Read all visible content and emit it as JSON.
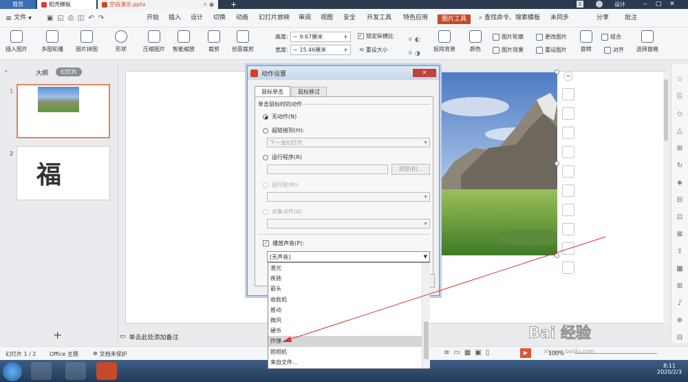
{
  "tabs": {
    "home": "首页",
    "template": "稻壳模板",
    "file": "空白演示.pptx",
    "add": "+",
    "counter": "1",
    "design": "设计"
  },
  "menu": {
    "file": "文件",
    "items": [
      "开始",
      "插入",
      "设计",
      "切换",
      "动画",
      "幻灯片放映",
      "审阅",
      "视图",
      "安全",
      "开发工具",
      "特色应用"
    ],
    "active": "图片工具",
    "search": "查找命令、搜索模板",
    "sync": "未同步",
    "share": "分享",
    "annotate": "批注"
  },
  "ribbon": {
    "buttons": [
      "插入图片",
      "多图轮播",
      "图片拼图",
      "形状",
      "压缩图片",
      "智能缩放",
      "裁剪",
      "创意裁剪"
    ],
    "height_label": "高度:",
    "height_value": "9.67厘米",
    "width_label": "宽度:",
    "width_value": "15.46厘米",
    "lock": "锁定纵横比",
    "reset": "重设大小",
    "cutout": "抠除背景",
    "color": "颜色",
    "outline": "图片轮廓",
    "effect": "图片效果",
    "change": "更改图片",
    "reset_pic": "重设图片",
    "group": "组合",
    "rotate": "旋转",
    "align": "对齐",
    "selection": "选择窗格"
  },
  "left": {
    "outline": "大纲",
    "slides": "幻灯片",
    "slide1": "1",
    "slide2": "2",
    "fu": "福",
    "add": "+"
  },
  "notes": "单击此处添加备注",
  "status": {
    "slides": "幻灯片 1 / 2",
    "theme": "Office 主题",
    "protect": "文档未保护",
    "zoom": "100%"
  },
  "dialog": {
    "title": "动作设置",
    "tab1": "鼠标单击",
    "tab2": "鼠标移过",
    "section": "单击鼠标时的动作",
    "none": "无动作(N)",
    "hyperlink": "超链接到(H):",
    "hyperlink_value": "下一张幻灯片",
    "program": "运行程序(R)",
    "browse": "浏览(B)...",
    "macro": "运行宏(M):",
    "object": "对象动作(A)",
    "sound": "播放声音(P):",
    "sound_value": "[无声音]"
  },
  "sounds": [
    "激光",
    "疾驰",
    "箭头",
    "收款机",
    "推动",
    "微风",
    "硬币",
    "炸弹",
    "照相机",
    "来自文件..."
  ],
  "taskbar": {
    "time": "8:11",
    "date": "2020/2/3",
    "watermark": "Bai 经验",
    "url": "jingyan.baidu.com"
  },
  "colors": {
    "accent": "#c44a2a",
    "blue": "#3b6db5"
  }
}
